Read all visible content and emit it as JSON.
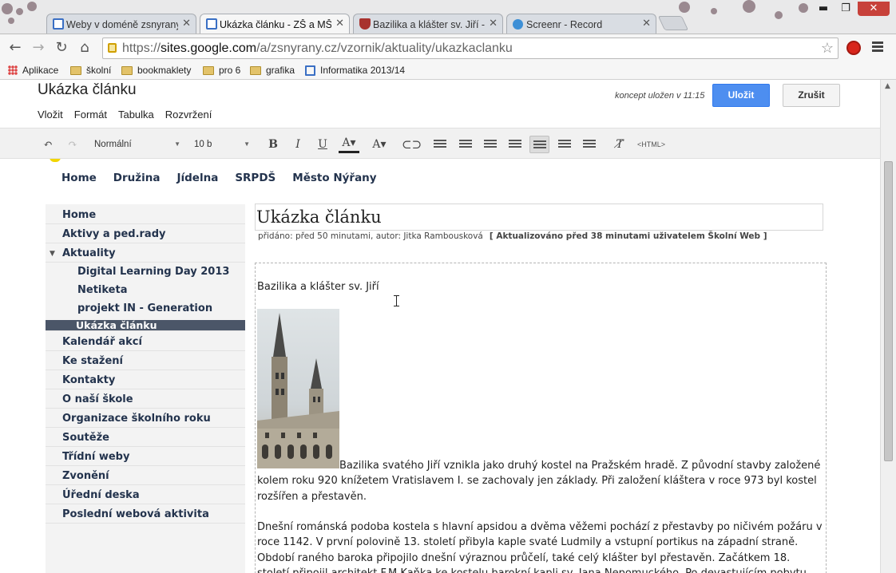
{
  "browser": {
    "tabs": [
      {
        "label": "Weby v doméně zsnyrany",
        "active": false,
        "icon": "sites-doc-icon"
      },
      {
        "label": "Ukázka článku - ZŠ a MŠ N",
        "active": true,
        "icon": "sites-doc-icon"
      },
      {
        "label": "Bazilika a klášter sv. Jiří - P",
        "active": false,
        "icon": "shield-icon"
      },
      {
        "label": "Screenr - Record",
        "active": false,
        "icon": "screenr-icon"
      }
    ],
    "close_glyph": "✕",
    "window_controls": {
      "minimize": "▬",
      "maximize": "❐",
      "close": "✕"
    },
    "url_prefix": "https://",
    "url_host": "sites.google.com",
    "url_path": "/a/zsnyrany.cz/vzornik/aktuality/ukazkaclanku",
    "bookmarks": [
      {
        "label": "Aplikace",
        "icon": "apps-grid-icon"
      },
      {
        "label": "školní",
        "icon": "folder-icon"
      },
      {
        "label": "bookmaklety",
        "icon": "folder-icon"
      },
      {
        "label": "pro 6",
        "icon": "folder-icon"
      },
      {
        "label": "grafika",
        "icon": "folder-icon"
      },
      {
        "label": "Informatika 2013/14",
        "icon": "sites-doc-icon"
      }
    ]
  },
  "editor": {
    "page_title": "Ukázka článku",
    "draft_status": "koncept uložen v 11:15",
    "save_label": "Uložit",
    "cancel_label": "Zrušit",
    "menus": [
      "Vložit",
      "Formát",
      "Tabulka",
      "Rozvržení"
    ],
    "toolbar": {
      "style_select": "Normální",
      "size_select": "10 b",
      "html_label": "<HTML>",
      "active_button": "align-left"
    }
  },
  "site": {
    "top_nav": [
      "Home",
      "Družina",
      "Jídelna",
      "SRPDŠ",
      "Město Nýřany"
    ],
    "sidebar": [
      {
        "label": "Home",
        "level": 0
      },
      {
        "label": "Aktivy a ped.rady",
        "level": 0
      },
      {
        "label": "Aktuality",
        "level": 0,
        "expanded": true
      },
      {
        "label": "Digital Learning Day 2013",
        "level": 1
      },
      {
        "label": "Netiketa",
        "level": 1
      },
      {
        "label": "projekt IN - Generation",
        "level": 1
      },
      {
        "label": "Ukázka článku",
        "level": 1,
        "selected": true
      },
      {
        "label": "Kalendář akcí",
        "level": 0
      },
      {
        "label": "Ke stažení",
        "level": 0
      },
      {
        "label": "Kontakty",
        "level": 0
      },
      {
        "label": "O naší škole",
        "level": 0
      },
      {
        "label": "Organizace školního roku",
        "level": 0
      },
      {
        "label": "Soutěže",
        "level": 0
      },
      {
        "label": "Třídní weby",
        "level": 0
      },
      {
        "label": "Zvonění",
        "level": 0
      },
      {
        "label": "Úřední deska",
        "level": 0
      },
      {
        "label": "Poslední webová aktivita",
        "level": 0
      }
    ],
    "article": {
      "title": "Ukázka článku",
      "meta": "přidáno: před 50 minutami, autor: Jitka Rambousková",
      "meta_updated": "[ Aktualizováno před 38 minutami uživatelem Školní Web ]",
      "subtitle": "Bazilika a klášter sv. Jiří",
      "para1": "Bazilika svatého Jiří vznikla jako druhý kostel na Pražském hradě. Z původní stavby založené kolem roku 920 knížetem Vratislavem I. se zachovaly jen základy. Při založení kláštera v roce 973 byl kostel rozšířen a přestavěn.",
      "para2": "Dnešní románská podoba kostela s hlavní apsidou a dvěma věžemi pochází z přestavby po ničivém požáru v roce 1142. V první polovině 13. století přibyla kaple svaté Ludmily a vstupní portikus na západní straně. Období raného baroka připojilo dnešní výraznou průčelí, také celý klášter byl přestavěn. Začátkem 18. století připojil architekt F.M.Kaňka ke kostelu barokní kapli sv. Jana Nepomuckého. Po devastujícím pobytu vojska v klášteře"
    }
  },
  "colors": {
    "accent": "#4d8ef0",
    "nav_text": "#23334d",
    "selected_item": "#4b5668",
    "close_button": "#c7413a"
  }
}
